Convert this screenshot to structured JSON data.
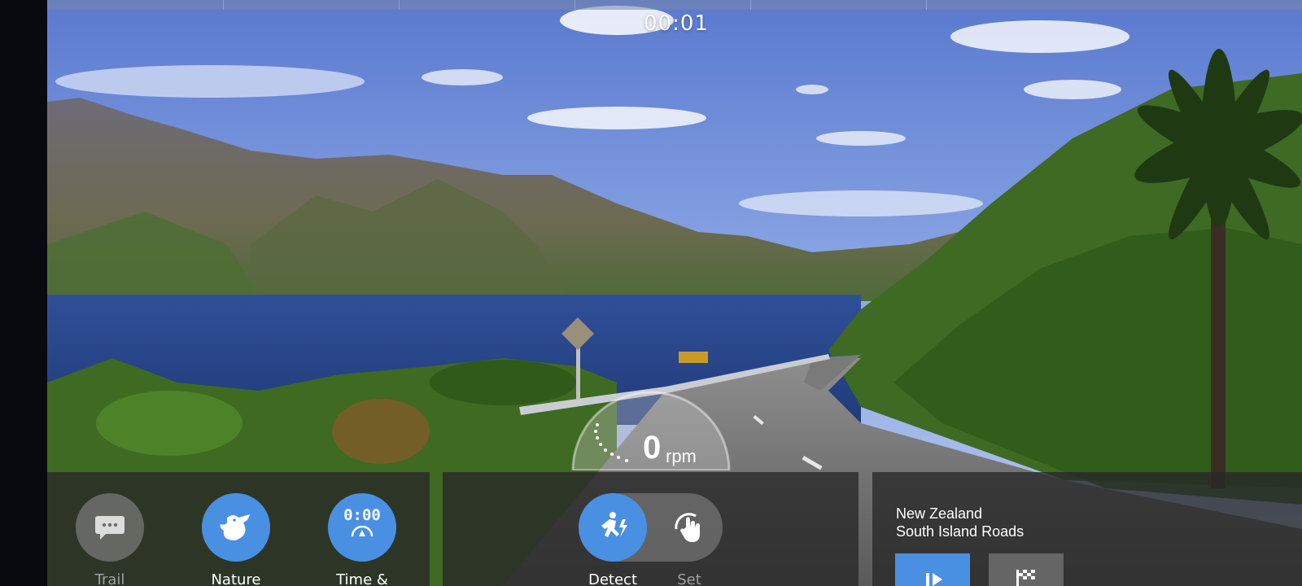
{
  "ride": {
    "elapsed_time": "00:01",
    "progress_fraction": 0.0
  },
  "cadence": {
    "value": "0",
    "unit": "rpm"
  },
  "left_panel": {
    "buttons": [
      {
        "label": "Trail",
        "icon": "chat-bubble-icon",
        "state": "inactive"
      },
      {
        "label": "Nature",
        "icon": "bird-icon",
        "state": "active"
      },
      {
        "label": "Time &",
        "icon": "clock-gauge-icon",
        "value": "0:00",
        "state": "active"
      }
    ]
  },
  "mid_panel": {
    "modes": [
      {
        "label": "Detect",
        "icon": "runner-bolt-icon",
        "state": "selected"
      },
      {
        "label": "Set",
        "icon": "hand-gauge-icon",
        "state": "unselected"
      }
    ]
  },
  "route": {
    "region": "New Zealand",
    "name": "South Island Roads",
    "play_icon": "play-icon",
    "finish_icon": "checkered-flag-icon"
  },
  "colors": {
    "accent": "#4a90e2",
    "panel": "#282828",
    "rail": "#070b10"
  }
}
